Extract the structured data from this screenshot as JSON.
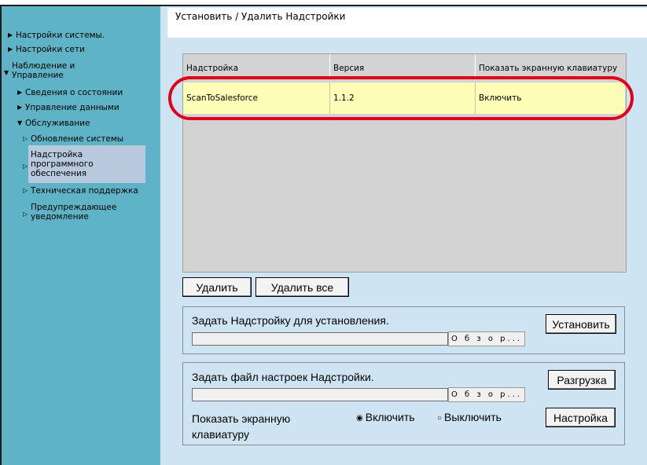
{
  "page": {
    "title": "Установить / Удалить Надстройки"
  },
  "sidebar": {
    "items": [
      {
        "label": "Настройки системы.",
        "arrow": "▶"
      },
      {
        "label": "Настройки сети",
        "arrow": "▶"
      },
      {
        "label": "Наблюдение и",
        "label2": "Управление",
        "arrow": "▼"
      },
      {
        "label": "Сведения о состоянии",
        "arrow": "▶"
      },
      {
        "label": "Управление данными",
        "arrow": "▶"
      },
      {
        "label": "Обслуживание",
        "arrow": "▼"
      },
      {
        "label": "Обновление системы",
        "arrow": "▷"
      },
      {
        "label": "Надстройка",
        "label2": "программного",
        "label3": "обеспечения",
        "arrow": "▷"
      },
      {
        "label": "Техническая поддержка",
        "arrow": "▷"
      },
      {
        "label": "Предупреждающее",
        "label2": "уведомление",
        "arrow": "▷"
      }
    ]
  },
  "table": {
    "columns": [
      "Надстройка",
      "Версия",
      "Показать экранную клавиатуру"
    ],
    "rows": [
      [
        "ScanToSalesforce",
        "1.1.2",
        "Включить"
      ]
    ]
  },
  "buttons": {
    "delete": "Удалить",
    "delete_all": "Удалить все",
    "install": "Установить",
    "upload": "Разгрузка",
    "settings": "Настройка",
    "browse": "О б з о р..."
  },
  "install_panel": {
    "label": "Задать Надстройку для установления."
  },
  "settings_panel": {
    "label": "Задать файл настроек Надстройки.",
    "keyboard_label_1": "Показать экранную",
    "keyboard_label_2": "клавиатуру",
    "radio_on": "Включить",
    "radio_off": "Выключить",
    "radio_selected": "Включить"
  },
  "colors": {
    "sidebar": "#5fb3c6",
    "panel": "#cfe4f3",
    "highlight_row": "#fdfdb7",
    "annotation_oval": "#e2001a"
  }
}
